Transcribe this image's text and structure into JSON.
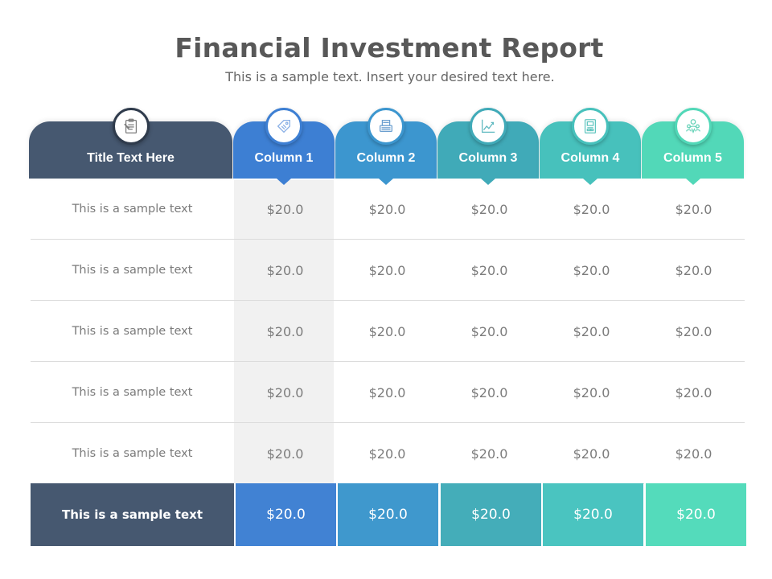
{
  "header": {
    "title": "Financial Investment Report",
    "subtitle": "This is a sample text. Insert your desired text here."
  },
  "table": {
    "title_header": {
      "label": "Title Text Here",
      "icon": "clipboard-icon",
      "color": "#465870"
    },
    "columns": [
      {
        "label": "Column 1",
        "icon": "price-tag-icon",
        "color": "#3d7fd3"
      },
      {
        "label": "Column 2",
        "icon": "typewriter-icon",
        "color": "#3c96cf"
      },
      {
        "label": "Column 3",
        "icon": "line-chart-icon",
        "color": "#40aab8"
      },
      {
        "label": "Column 4",
        "icon": "document-report-icon",
        "color": "#47c1bc"
      },
      {
        "label": "Column 5",
        "icon": "team-leader-icon",
        "color": "#52d8b8"
      }
    ],
    "highlighted_column": 1,
    "rows": [
      {
        "label": "This is a sample text",
        "values": [
          "$20.0",
          "$20.0",
          "$20.0",
          "$20.0",
          "$20.0"
        ]
      },
      {
        "label": "This is a sample text",
        "values": [
          "$20.0",
          "$20.0",
          "$20.0",
          "$20.0",
          "$20.0"
        ]
      },
      {
        "label": "This is a sample text",
        "values": [
          "$20.0",
          "$20.0",
          "$20.0",
          "$20.0",
          "$20.0"
        ]
      },
      {
        "label": "This is a sample text",
        "values": [
          "$20.0",
          "$20.0",
          "$20.0",
          "$20.0",
          "$20.0"
        ]
      },
      {
        "label": "This is a sample text",
        "values": [
          "$20.0",
          "$20.0",
          "$20.0",
          "$20.0",
          "$20.0"
        ]
      }
    ],
    "footer": {
      "label": "This is a sample text",
      "values": [
        "$20.0",
        "$20.0",
        "$20.0",
        "$20.0",
        "$20.0"
      ]
    }
  }
}
